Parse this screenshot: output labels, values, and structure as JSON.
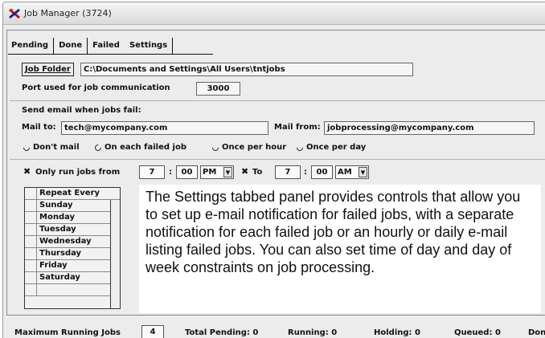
{
  "window": {
    "title": "Job Manager (3724)",
    "icon": "app-logo-icon"
  },
  "tabs": [
    {
      "label": "Pending"
    },
    {
      "label": "Done"
    },
    {
      "label": "Failed"
    },
    {
      "label": "Settings"
    }
  ],
  "job_folder": {
    "button_label": "Job Folder",
    "value": "C:\\Documents and Settings\\All Users\\tntjobs"
  },
  "port": {
    "label": "Port used for job communication",
    "value": "3000"
  },
  "email": {
    "section_label": "Send email when jobs fail:",
    "mail_to_label": "Mail to:",
    "mail_to_value": "tech@mycompany.com",
    "mail_from_label": "Mail from:",
    "mail_from_value": "jobprocessing@mycompany.com",
    "options": [
      {
        "label": "Don't mail",
        "selected": false
      },
      {
        "label": "On each failed job",
        "selected": true
      },
      {
        "label": "Once per hour",
        "selected": false
      },
      {
        "label": "Once per day",
        "selected": false
      }
    ]
  },
  "schedule": {
    "only_run_label": "Only run jobs from",
    "from_hour": "7",
    "from_min": "00",
    "from_ampm": "PM",
    "to_label": "To",
    "to_hour": "7",
    "to_min": "00",
    "to_ampm": "AM",
    "colon": ":"
  },
  "days": {
    "header": "Repeat Every",
    "items": [
      "Sunday",
      "Monday",
      "Tuesday",
      "Wednesday",
      "Thursday",
      "Friday",
      "Saturday",
      ""
    ]
  },
  "callout": {
    "text": "The Settings tabbed panel provides controls that allow you to set up e-mail notification for failed jobs, with a separate notification for each failed job or an hourly or daily e-mail listing failed jobs.  You can also set time of day and day of week constraints on job processing."
  },
  "status": {
    "max_running_label": "Maximum Running Jobs",
    "max_running_value": "4",
    "total_pending": "Total Pending: 0",
    "running": "Running: 0",
    "holding": "Holding: 0",
    "queued": "Queued: 0",
    "done": "Done"
  }
}
